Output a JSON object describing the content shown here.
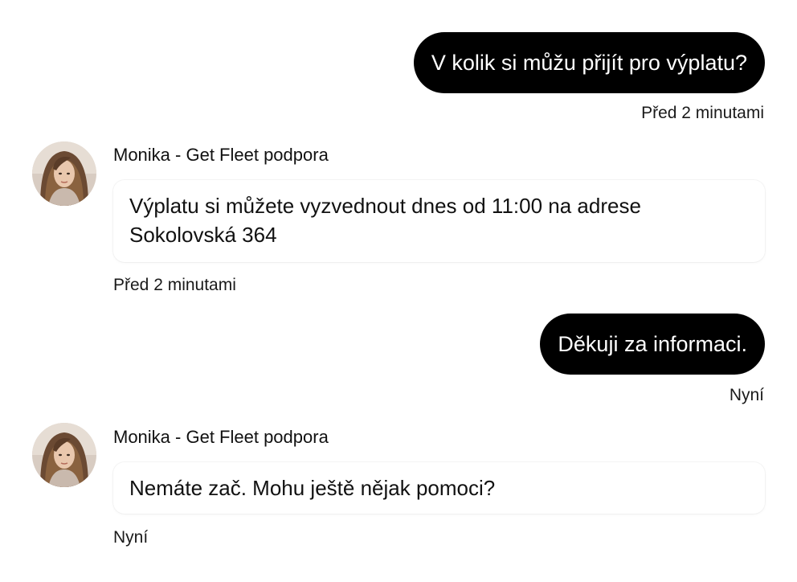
{
  "conversation": {
    "messages": [
      {
        "direction": "outgoing",
        "text": "V kolik si můžu přijít pro výplatu?",
        "time": "Před 2 minutami"
      },
      {
        "direction": "incoming",
        "sender": "Monika - Get Fleet podpora",
        "avatar_icon": "user-avatar-photo",
        "text": "Výplatu si můžete vyzvednout dnes od 11:00 na adrese Sokolovská 364",
        "time": "Před 2 minutami"
      },
      {
        "direction": "outgoing",
        "text": "Děkuji za informaci.",
        "time": "Nyní"
      },
      {
        "direction": "incoming",
        "sender": "Monika - Get Fleet podpora",
        "avatar_icon": "user-avatar-photo",
        "text": "Nemáte zač. Mohu ještě nějak pomoci?",
        "time": "Nyní"
      }
    ]
  },
  "colors": {
    "outgoing_bubble": "#000000",
    "outgoing_text": "#ffffff",
    "incoming_bubble": "#ffffff",
    "text": "#111111",
    "background": "#ffffff"
  }
}
